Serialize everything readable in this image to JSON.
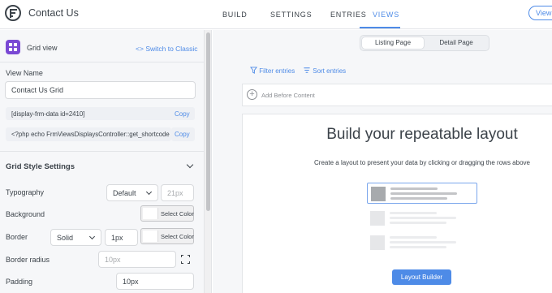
{
  "header": {
    "form_title": "Contact Us",
    "tabs": [
      {
        "label": "BUILD",
        "active": false
      },
      {
        "label": "SETTINGS",
        "active": false
      },
      {
        "label": "ENTRIES",
        "active": false
      },
      {
        "label": "VIEWS",
        "active": true
      }
    ],
    "view_button": "View"
  },
  "sidebar": {
    "view_type_label": "Grid view",
    "switch_link": "Switch to Classic",
    "view_name_label": "View Name",
    "view_name_value": "Contact Us Grid",
    "shortcode": "[display-frm-data id=2410]",
    "php_code": "<?php echo FrmViewsDisplaysController::get_shortcode",
    "copy_label": "Copy",
    "grid_style": {
      "title": "Grid Style Settings",
      "typography_label": "Typography",
      "typography_value": "Default",
      "font_size_placeholder": "21px",
      "background_label": "Background",
      "select_color_label": "Select Color",
      "border_label": "Border",
      "border_style_value": "Solid",
      "border_width_value": "1px",
      "border_radius_label": "Border radius",
      "border_radius_placeholder": "10px",
      "padding_label": "Padding",
      "padding_value": "10px"
    }
  },
  "main": {
    "page_toggle": [
      {
        "label": "Listing Page",
        "selected": true
      },
      {
        "label": "Detail Page",
        "selected": false
      }
    ],
    "filter_entries": "Filter entries",
    "sort_entries": "Sort entries",
    "add_before_content": "Add Before Content",
    "empty_title": "Build your repeatable layout",
    "empty_subtitle": "Create a layout to present your data by clicking or dragging the rows above",
    "layout_builder_button": "Layout Builder"
  },
  "colors": {
    "accent": "#4e8be7",
    "grid_icon": "#7948d4",
    "text": "#3c434a",
    "sidebar_bg": "#f6f7f9"
  },
  "icons": [
    "formidable-logo-icon",
    "grid-view-icon",
    "code-icon",
    "chevron-down-icon",
    "filter-icon",
    "sort-icon",
    "plus-circle-icon",
    "expand-icon"
  ]
}
